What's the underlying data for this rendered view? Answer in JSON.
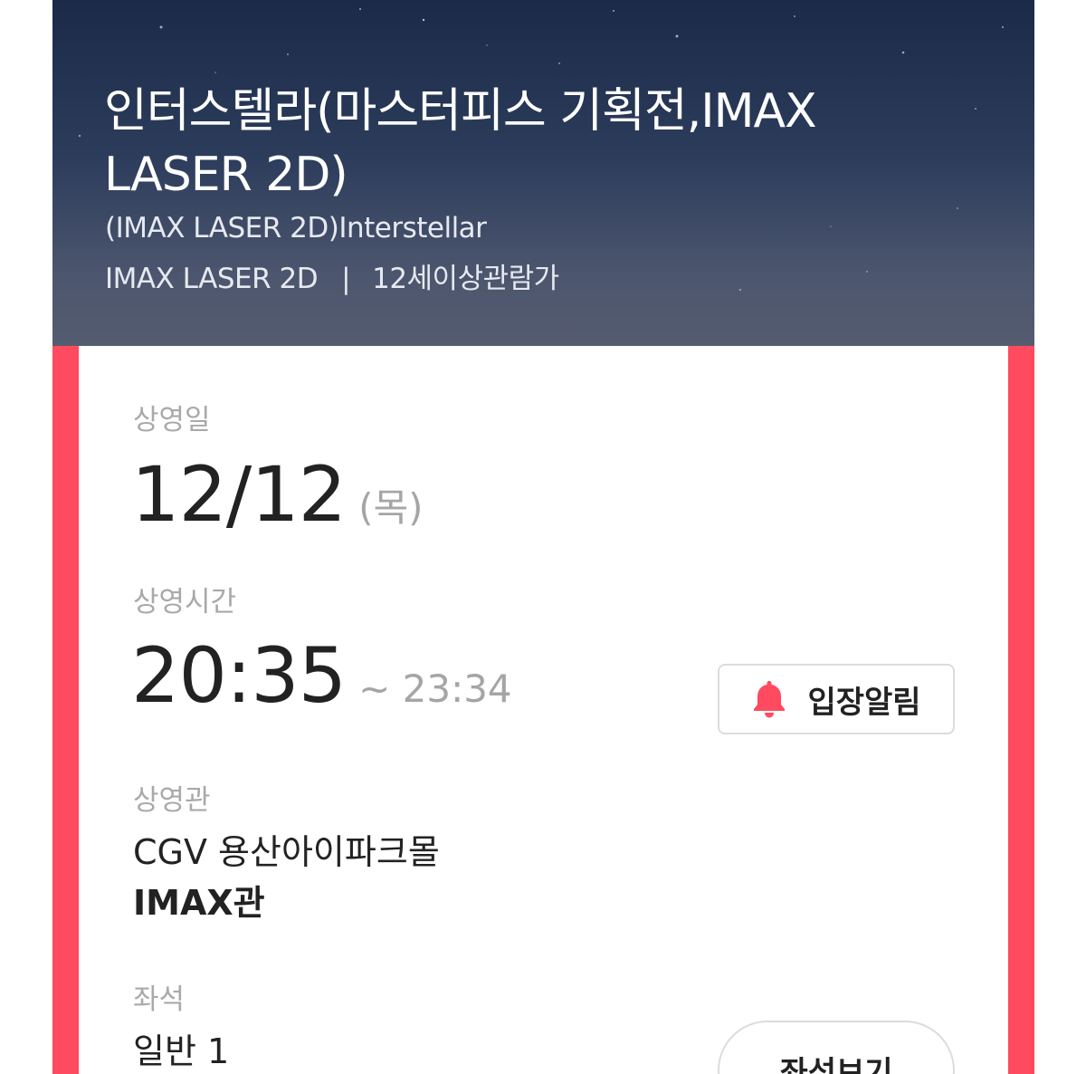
{
  "movie": {
    "title": "인터스텔라(마스터피스 기획전,IMAX LASER 2D)",
    "original_title": "(IMAX LASER 2D)Interstellar",
    "format": "IMAX LASER 2D",
    "separator": "|",
    "rating": "12세이상관람가"
  },
  "schedule": {
    "date_label": "상영일",
    "date": "12/12",
    "weekday": "(목)",
    "time_label": "상영시간",
    "start_time": "20:35",
    "end_time": "~ 23:34"
  },
  "theater": {
    "label": "상영관",
    "cinema": "CGV 용산아이파크몰",
    "hall": "IMAX관"
  },
  "seat": {
    "label": "좌석",
    "value": "일반 1"
  },
  "buttons": {
    "entry_alarm": "입장알림",
    "view_seats": "좌석보기"
  },
  "icons": {
    "alarm": "bell-icon"
  },
  "colors": {
    "accent": "#ff4a5f",
    "hero_dark": "#1a2a48",
    "label_gray": "#a9a9a9"
  }
}
